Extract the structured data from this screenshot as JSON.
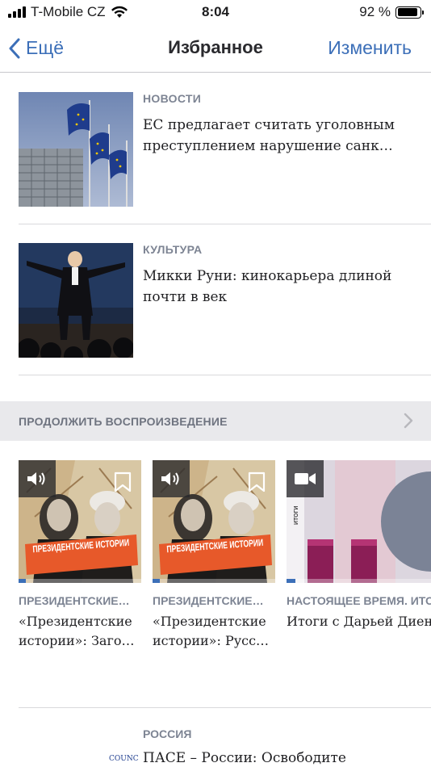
{
  "status_bar": {
    "carrier": "T-Mobile CZ",
    "time": "8:04",
    "battery_percent": "92 %",
    "battery_level": 0.92
  },
  "nav": {
    "back_label": "Ещё",
    "title": "Избранное",
    "edit_label": "Изменить"
  },
  "articles": [
    {
      "category": "НОВОСТИ",
      "title": "ЕС предлагает считать уголовным преступлением нарушение санк…",
      "thumbnail_icon": "eu-flags-photo"
    },
    {
      "category": "КУЛЬТУРА",
      "title": "Микки Руни: кинокарьера длиной почти в век",
      "thumbnail_icon": "stage-performer-photo"
    }
  ],
  "continue_section": {
    "label": "ПРОДОЛЖИТЬ ВОСПРОИЗВЕДЕНИЕ",
    "chevron_icon": "chevron-right-icon"
  },
  "carousel": [
    {
      "category": "ПРЕЗИДЕНТСКИЕ…",
      "title": "«Президентские истории»: Заго…",
      "media_icon": "speaker-icon",
      "thumb_text": "ПРЕЗИДЕНТСКИЕ ИСТОРИИ",
      "progress": 0.06
    },
    {
      "category": "ПРЕЗИДЕНТСКИЕ…",
      "title": "«Президентские истории»: Русс…",
      "media_icon": "speaker-icon",
      "thumb_text": "ПРЕЗИДЕНТСКИЕ ИСТОРИИ",
      "progress": 0.06
    },
    {
      "category": "НАСТОЯЩЕЕ ВРЕМЯ. ИТОГИ",
      "title": "Итоги с Дарьей Диен",
      "media_icon": "video-camera-icon",
      "thumb_text": "ИТОГИ",
      "progress": 0.06
    }
  ],
  "partial_article": {
    "category": "РОССИЯ",
    "title": "ПАСЕ – России: Освободите",
    "thumb_text": "COUNC"
  },
  "colors": {
    "accent": "#3c6fb8",
    "category_text": "#7d8493",
    "section_bg": "#e9e9ec",
    "thumb_orange": "#e7592a"
  }
}
